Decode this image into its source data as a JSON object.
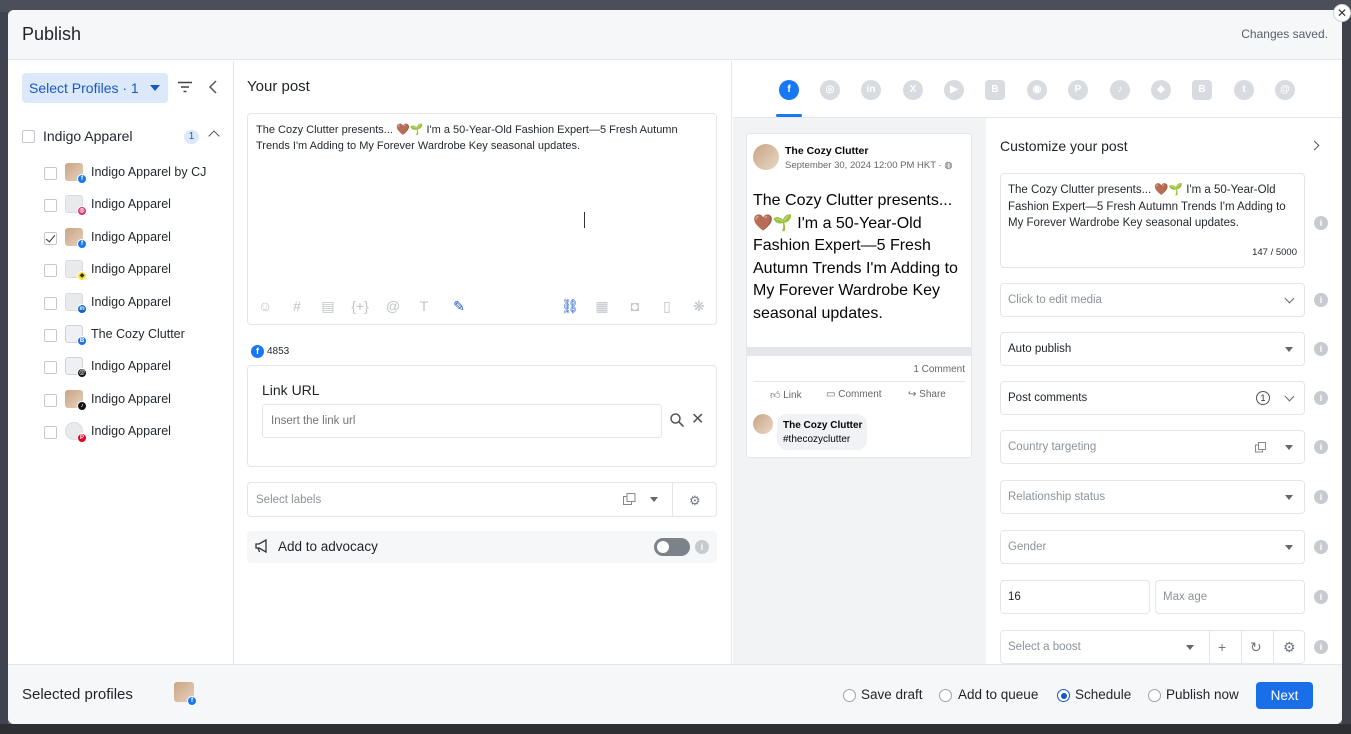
{
  "header": {
    "title": "Publish",
    "status": "Changes saved."
  },
  "left": {
    "select_profiles": "Select Profiles · 1",
    "group": {
      "name": "Indigo Apparel",
      "count": "1"
    },
    "profiles": [
      {
        "label": "Indigo Apparel by CJ",
        "network": "facebook",
        "checked": false
      },
      {
        "label": "Indigo Apparel",
        "network": "instagram",
        "checked": false
      },
      {
        "label": "Indigo Apparel",
        "network": "facebook",
        "checked": true
      },
      {
        "label": "Indigo Apparel",
        "network": "snapchat",
        "checked": false
      },
      {
        "label": "Indigo Apparel",
        "network": "linkedin",
        "checked": false
      },
      {
        "label": "The Cozy Clutter",
        "network": "google-business",
        "checked": false
      },
      {
        "label": "Indigo Apparel",
        "network": "threads",
        "checked": false
      },
      {
        "label": "Indigo Apparel",
        "network": "tiktok",
        "checked": false
      },
      {
        "label": "Indigo Apparel",
        "network": "pinterest",
        "checked": false
      }
    ]
  },
  "editor": {
    "title": "Your post",
    "text": "The Cozy Clutter presents... 🤎🌱 I'm a 50-Year-Old Fashion Expert—5 Fresh Autumn Trends I'm Adding to My Forever Wardrobe Key seasonal updates.",
    "fb_char_count": "4853"
  },
  "link": {
    "title": "Link URL",
    "placeholder": "Insert the link url"
  },
  "labels": {
    "placeholder": "Select labels"
  },
  "advocacy": {
    "label": "Add to advocacy"
  },
  "preview": {
    "page_name": "The Cozy Clutter",
    "date": "September 30, 2024 12:00 PM HKT · ◍",
    "text": "The Cozy Clutter presents... 🤎🌱 I'm a 50-Year-Old Fashion Expert—5 Fresh Autumn Trends I'm Adding to My Forever Wardrobe Key seasonal updates.",
    "comments": "1 Comment",
    "actions": {
      "like": "Link",
      "comment": "Comment",
      "share": "Share"
    },
    "comment": {
      "name": "The Cozy Clutter",
      "text": "#thecozyclutter"
    }
  },
  "customize": {
    "title": "Customize your post",
    "text": "The Cozy Clutter presents... 🤎🌱 I'm a 50-Year-Old Fashion Expert—5 Fresh Autumn Trends I'm Adding to My Forever Wardrobe Key seasonal updates.",
    "counter": "147 / 5000",
    "media": "Click to edit media",
    "publish_mode": "Auto publish",
    "post_comments": "Post comments",
    "post_comments_count": "1",
    "country": "Country targeting",
    "relationship": "Relationship status",
    "gender": "Gender",
    "min_age": "16",
    "max_age_placeholder": "Max age",
    "boost": "Select a boost"
  },
  "footer": {
    "selected_profiles": "Selected profiles",
    "options": [
      "Save draft",
      "Add to queue",
      "Schedule",
      "Publish now"
    ],
    "selected_option": "Schedule",
    "next": "Next"
  },
  "networks": [
    "facebook",
    "instagram",
    "linkedin",
    "x",
    "youtube",
    "google-business",
    "reddit",
    "pinterest",
    "tiktok",
    "snapchat",
    "blogger",
    "tumblr",
    "threads"
  ],
  "colors": {
    "accent": "#1a6fe8",
    "facebook": "#1877f2"
  }
}
